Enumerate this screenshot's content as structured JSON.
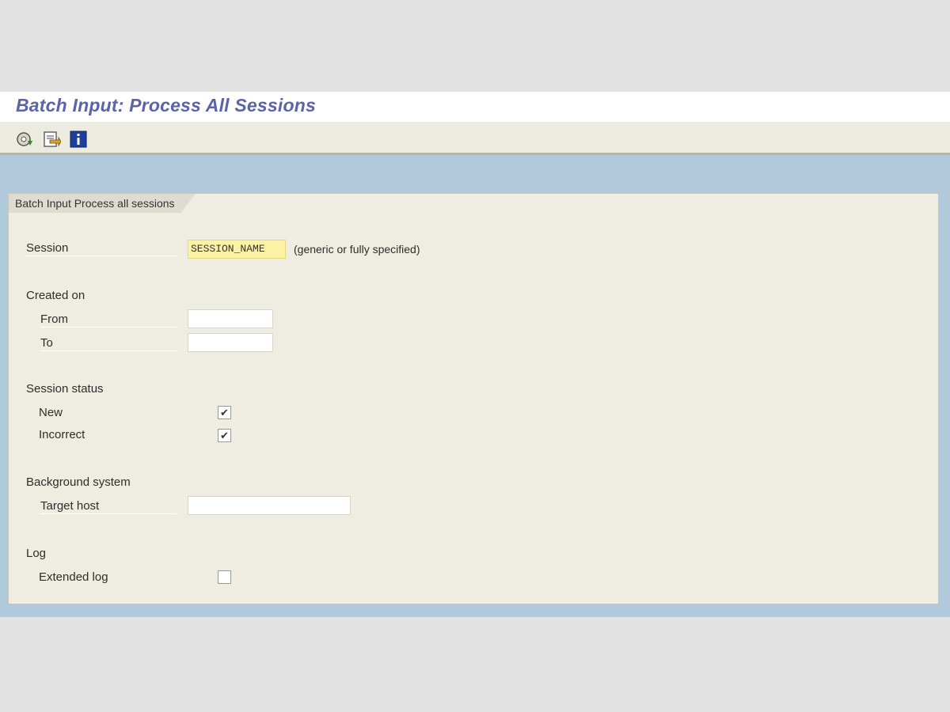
{
  "window": {
    "title": "Batch Input: Process All Sessions"
  },
  "toolbar": {
    "buttons": [
      {
        "icon": "execute-icon"
      },
      {
        "icon": "get-variant-icon"
      },
      {
        "icon": "info-icon"
      }
    ]
  },
  "form": {
    "frame_title": "Batch Input Process all sessions",
    "session": {
      "label": "Session",
      "value": "SESSION_NAME",
      "hint": "(generic or fully specified)"
    },
    "created_on": {
      "label": "Created on",
      "from_label": "From",
      "from_value": "",
      "to_label": "To",
      "to_value": ""
    },
    "session_status": {
      "label": "Session status",
      "new_label": "New",
      "new_checked": true,
      "incorrect_label": "Incorrect",
      "incorrect_checked": true
    },
    "background_system": {
      "label": "Background system",
      "target_host_label": "Target host",
      "target_host_value": ""
    },
    "log": {
      "label": "Log",
      "extended_log_label": "Extended log",
      "extended_log_checked": false
    }
  },
  "colors": {
    "title_text": "#5b64a8",
    "canvas_background": "#b0cadb",
    "frame_background": "#efece1",
    "required_field": "#fbf2a4"
  }
}
